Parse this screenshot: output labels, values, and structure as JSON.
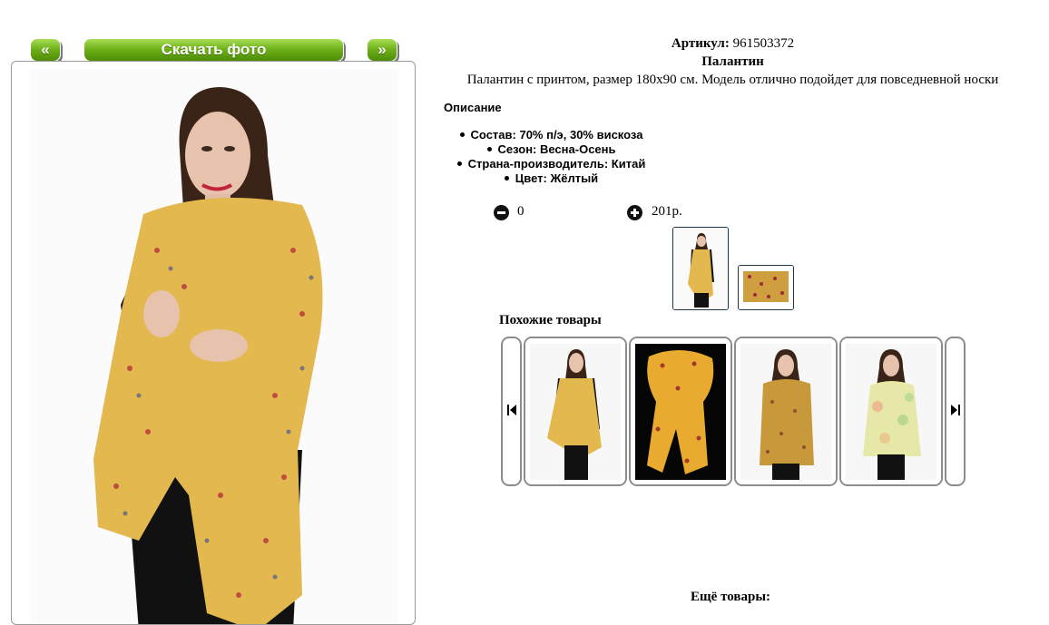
{
  "nav": {
    "prev_label": "«",
    "next_label": "»",
    "download_label": "Скачать фото"
  },
  "product": {
    "article_label": "Артикул:",
    "article_value": "961503372",
    "name": "Палантин",
    "summary": "Палантин с принтом, размер 180x90 см. Модель отлично подойдет для повседневной носки"
  },
  "description": {
    "title": "Описание",
    "props": [
      "Состав: 70% п/э, 30% вискоза",
      "Сезон: Весна-Осень",
      "Страна-производитель: Китай",
      "Цвет: Жёлтый"
    ]
  },
  "order": {
    "quantity": "0",
    "price": "201р.",
    "minus_icon": "minus-circle-icon",
    "plus_icon": "plus-circle-icon"
  },
  "similar": {
    "title": "Похожие товары",
    "prev_icon": "skip-back-icon",
    "next_icon": "skip-forward-icon"
  },
  "more": {
    "title": "Ещё товары:"
  },
  "colors": {
    "button_green": "#6cae17",
    "scarf_yellow": "#e3b84f",
    "card_border": "#8c8c8c",
    "thumb_border": "#1c3650"
  }
}
